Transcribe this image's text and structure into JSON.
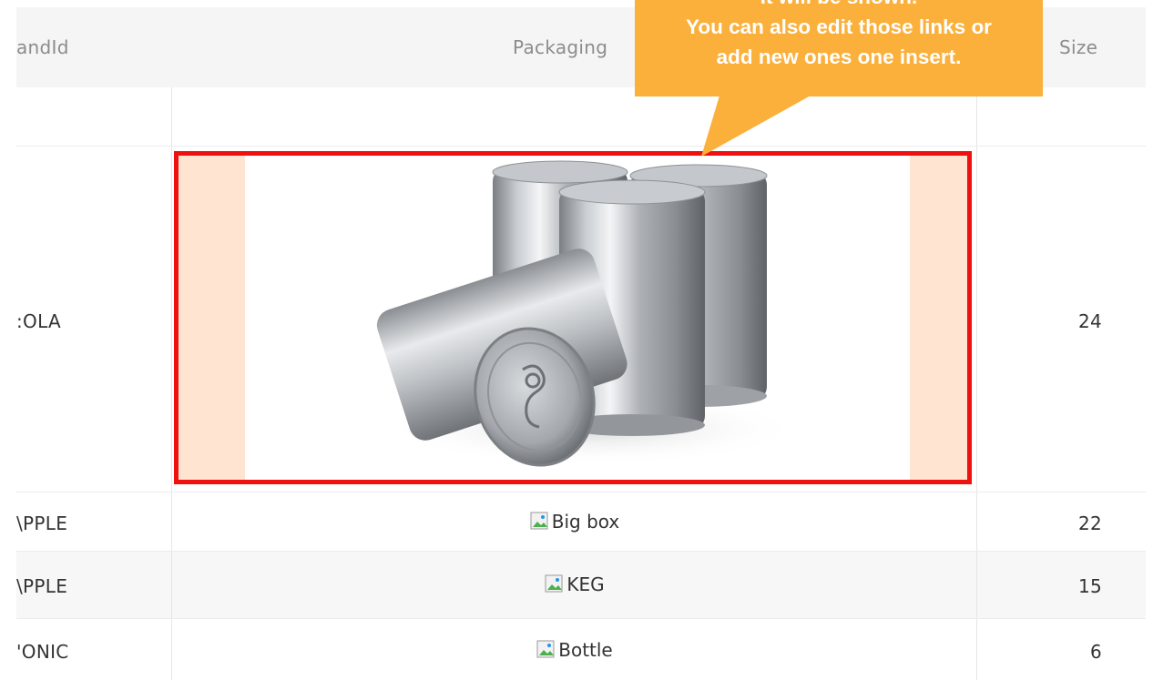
{
  "table": {
    "columns": [
      {
        "key": "brand",
        "label": "andId"
      },
      {
        "key": "packaging",
        "label": "Packaging"
      },
      {
        "key": "size",
        "label": "Size"
      }
    ],
    "rows": [
      {
        "brand": "",
        "packaging": "",
        "size": ""
      },
      {
        "brand": ":OLA",
        "packaging_image": "aluminum-cans-photo",
        "size": "24"
      },
      {
        "brand": "\\PPLE",
        "packaging": "Big box",
        "size": "22"
      },
      {
        "brand": "\\PPLE",
        "packaging": "KEG",
        "size": "15"
      },
      {
        "brand": "'ONIC",
        "packaging": "Bottle",
        "size": "6"
      }
    ]
  },
  "callout": {
    "line1": "It will be shown.",
    "line2": "You can also edit those links or",
    "line3": "add new ones one insert."
  },
  "colors": {
    "callout": "#fbb03b",
    "highlight_border": "#ef1010",
    "image_cell_bg": "#ffe4d2",
    "header_bg": "#f5f5f5",
    "alt_row_bg": "#f7f7f7"
  },
  "icons": {
    "broken_image": "broken-image-icon"
  }
}
